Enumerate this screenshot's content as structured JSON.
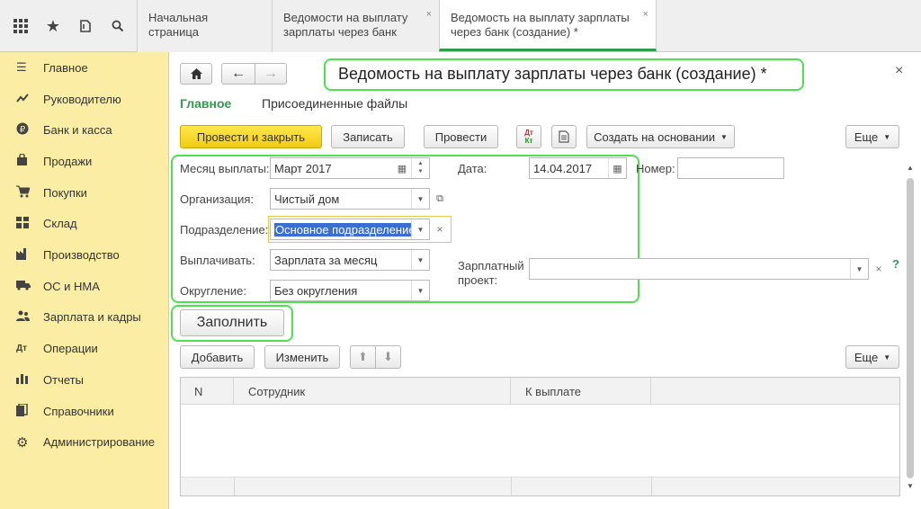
{
  "topbar": {
    "tabs": [
      {
        "label": "Начальная страница"
      },
      {
        "label": "Ведомости на выплату зарплаты через банк"
      },
      {
        "label": "Ведомость на выплату зарплаты через банк (создание) *"
      }
    ],
    "close_glyph": "×"
  },
  "sidebar": {
    "items": [
      {
        "label": "Главное",
        "icon": "menu-icon"
      },
      {
        "label": "Руководителю",
        "icon": "trend-icon"
      },
      {
        "label": "Банк и касса",
        "icon": "ruble-icon"
      },
      {
        "label": "Продажи",
        "icon": "bag-icon"
      },
      {
        "label": "Покупки",
        "icon": "cart-icon"
      },
      {
        "label": "Склад",
        "icon": "warehouse-icon"
      },
      {
        "label": "Производство",
        "icon": "factory-icon"
      },
      {
        "label": "ОС и НМА",
        "icon": "truck-icon"
      },
      {
        "label": "Зарплата и кадры",
        "icon": "people-icon"
      },
      {
        "label": "Операции",
        "icon": "operations-icon"
      },
      {
        "label": "Отчеты",
        "icon": "bar-chart-icon"
      },
      {
        "label": "Справочники",
        "icon": "book-icon"
      },
      {
        "label": "Администрирование",
        "icon": "gear-icon"
      }
    ]
  },
  "form": {
    "title": "Ведомость на выплату зарплаты через банк (создание) *",
    "close": "×",
    "subtabs": {
      "main": "Главное",
      "files": "Присоединенные файлы"
    },
    "toolbar": {
      "post_close": "Провести и закрыть",
      "save": "Записать",
      "post": "Провести",
      "create_based": "Создать на основании",
      "more": "Еще",
      "dt_kt": "Дт Кт"
    },
    "fields": {
      "month_label": "Месяц выплаты:",
      "month_value": "Март 2017",
      "date_label": "Дата:",
      "date_value": "14.04.2017",
      "number_label": "Номер:",
      "number_value": "",
      "org_label": "Организация:",
      "org_value": "Чистый дом",
      "dept_label": "Подразделение:",
      "dept_value": "Основное подразделение",
      "pay_label": "Выплачивать:",
      "pay_value": "Зарплата за месяц",
      "round_label": "Округление:",
      "round_value": "Без округления",
      "project_label": "Зарплатный проект:",
      "project_value": "",
      "help": "?"
    },
    "fill_button": "Заполнить",
    "table_toolbar": {
      "add": "Добавить",
      "edit": "Изменить",
      "more": "Еще"
    },
    "table": {
      "columns": [
        "N",
        "Сотрудник",
        "К выплате"
      ],
      "rows": []
    },
    "colors": {
      "accent_green": "#4fe04f",
      "sidebar_bg": "#fbeea4",
      "primary_yellow": "#f2cb14",
      "link_green": "#2e9b4e"
    }
  }
}
